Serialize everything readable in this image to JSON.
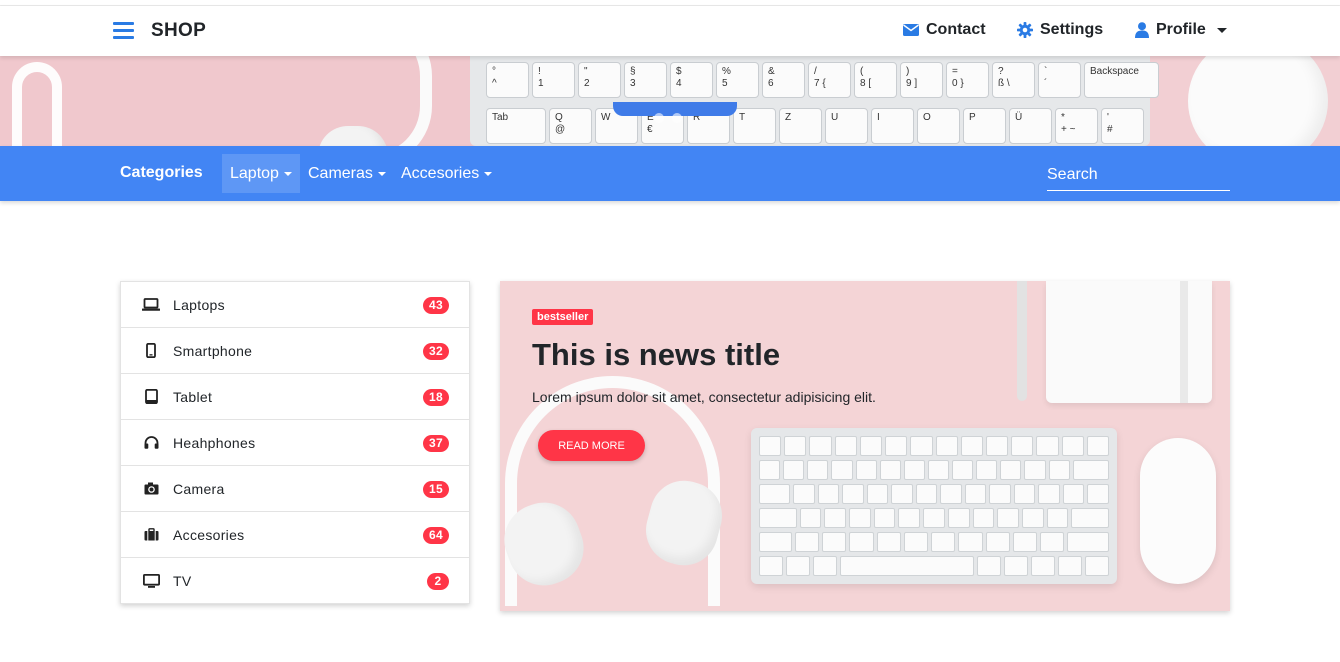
{
  "topnav": {
    "brand": "SHOP",
    "contact_label": "Contact",
    "settings_label": "Settings",
    "profile_label": "Profile"
  },
  "hero_keys": {
    "row1": [
      "°\n^",
      "!\n1",
      "\"\n2",
      "§\n3",
      "$\n4",
      "%\n5",
      "&\n6",
      "/\n7 {",
      "(\n8 [",
      ")\n9 ]",
      "=\n0 }",
      "?\nß \\",
      "`\n´",
      "Backspace"
    ],
    "row2": [
      "Tab",
      "Q\n@",
      "W",
      "E\n€",
      "R",
      "T",
      "Z",
      "U",
      "I",
      "O",
      "P",
      "Ü",
      "*\n+ ~",
      "'\n#"
    ]
  },
  "catbar": {
    "title": "Categories",
    "items": [
      {
        "label": "Laptop",
        "active": true
      },
      {
        "label": "Cameras",
        "active": false
      },
      {
        "label": "Accesories",
        "active": false
      }
    ],
    "search_placeholder": "Search"
  },
  "categories": [
    {
      "label": "Laptops",
      "count": "43",
      "icon": "laptop-icon"
    },
    {
      "label": "Smartphone",
      "count": "32",
      "icon": "smartphone-icon"
    },
    {
      "label": "Tablet",
      "count": "18",
      "icon": "tablet-icon"
    },
    {
      "label": "Heahphones",
      "count": "37",
      "icon": "headphones-icon"
    },
    {
      "label": "Camera",
      "count": "15",
      "icon": "camera-icon"
    },
    {
      "label": "Accesories",
      "count": "64",
      "icon": "briefcase-icon"
    },
    {
      "label": "TV",
      "count": "2",
      "icon": "tv-icon"
    }
  ],
  "news": {
    "badge": "bestseller",
    "title": "This is news title",
    "text": "Lorem ipsum dolor sit amet, consectetur adipisicing elit.",
    "button": "READ MORE"
  },
  "colors": {
    "primary_blue": "#4285f4",
    "accent_red": "#ff3547",
    "icon_blue": "#2a7be4"
  }
}
